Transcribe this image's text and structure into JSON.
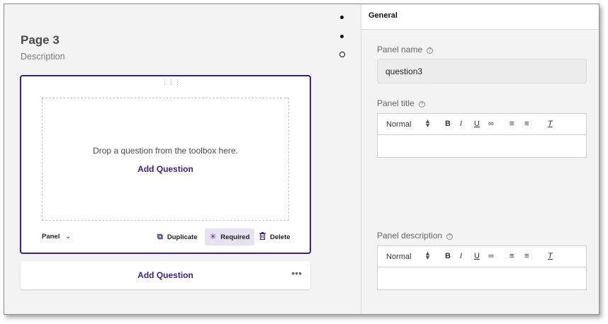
{
  "canvas": {
    "page_title": "Page 3",
    "page_description": "Description",
    "panel": {
      "drop_text": "Drop a question from the toolbox here.",
      "add_question": "Add Question",
      "type_label": "Panel",
      "actions": {
        "duplicate": "Duplicate",
        "required": "Required",
        "delete": "Delete"
      }
    },
    "add_question_bottom": "Add Question",
    "more_label": "•••"
  },
  "properties": {
    "section_title": "General",
    "panel_name": {
      "label": "Panel name",
      "value": "question3"
    },
    "panel_title": {
      "label": "Panel title",
      "format": "Normal"
    },
    "panel_description": {
      "label": "Panel description",
      "format": "Normal"
    }
  },
  "icons": {
    "help": "?",
    "chevron": "⌄",
    "duplicate": "⧉",
    "required": "✳",
    "delete": "Ὕ1",
    "bold": "B",
    "italic": "I",
    "underline": "U",
    "link": "🔗",
    "ordered_list": "☰",
    "bullet_list": "☰",
    "clear_format": "Tₓ"
  },
  "colors": {
    "accent": "#3b1f8f",
    "required_bg": "#e6e2f2"
  }
}
